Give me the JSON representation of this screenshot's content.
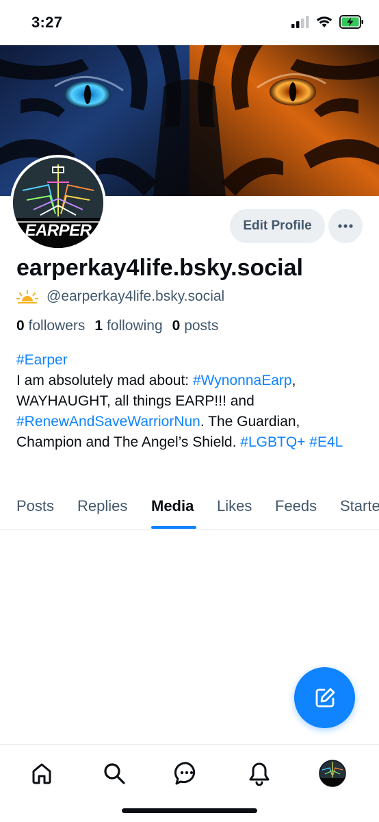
{
  "status_bar": {
    "time": "3:27"
  },
  "profile": {
    "avatar_text": "EARPER",
    "display_name": "earperkay4life.bsky.social",
    "handle": "@earperkay4life.bsky.social",
    "handle_icon": "sun-icon"
  },
  "actions": {
    "edit_profile_label": "Edit Profile",
    "more_label": "···"
  },
  "stats": {
    "followers_count": "0",
    "followers_label": "followers",
    "following_count": "1",
    "following_label": "following",
    "posts_count": "0",
    "posts_label": "posts"
  },
  "bio": {
    "line1_tag": "#Earper",
    "intro": "I am absolutely mad about: ",
    "tag_wynonna": "#WynonnaEarp",
    "text2": ", WAYHAUGHT, all things EARP!!! and ",
    "tag_renew": "#RenewAndSaveWarriorNun",
    "text3": ". The Guardian, Champion and The Angel’s Shield. ",
    "tag_lgbtq": "#LGBTQ+",
    "tag_e4l": "#E4L"
  },
  "tabs": [
    {
      "label": "Posts",
      "active": false
    },
    {
      "label": "Replies",
      "active": false
    },
    {
      "label": "Media",
      "active": true
    },
    {
      "label": "Likes",
      "active": false
    },
    {
      "label": "Feeds",
      "active": false
    },
    {
      "label": "Starte",
      "active": false
    }
  ],
  "bottom_nav": [
    {
      "icon": "home-icon"
    },
    {
      "icon": "search-icon"
    },
    {
      "icon": "chat-icon"
    },
    {
      "icon": "bell-icon"
    },
    {
      "icon": "avatar"
    }
  ],
  "colors": {
    "accent": "#1083fe",
    "muted": "#42576c",
    "text": "#0b0f14",
    "button_bg": "#eceff2"
  }
}
